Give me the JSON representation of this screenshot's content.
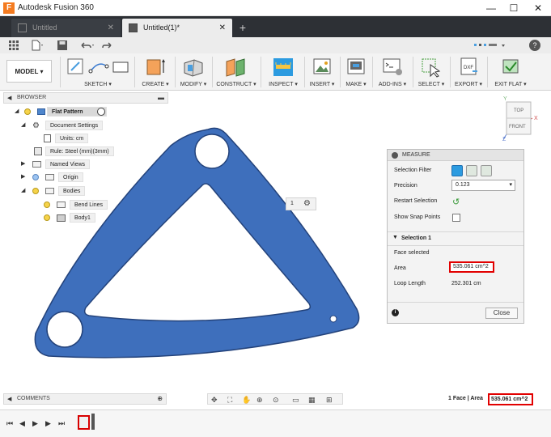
{
  "titlebar": {
    "app_icon_letter": "F",
    "title": "Autodesk Fusion 360",
    "minimize": "—",
    "maximize": "☐",
    "close": "✕"
  },
  "tabs": [
    {
      "label": "Untitled",
      "active": false,
      "close": "✕"
    },
    {
      "label": "Untitled(1)*",
      "active": true,
      "close": "✕"
    }
  ],
  "tab_add": "+",
  "quick_toolbar": {
    "help": "?"
  },
  "ribbon": {
    "workspace": "MODEL ▾",
    "groups": [
      "SKETCH ▾",
      "CREATE ▾",
      "MODIFY ▾",
      "CONSTRUCT ▾",
      "INSPECT ▾",
      "INSERT ▾",
      "MAKE ▾",
      "ADD-INS ▾",
      "SELECT ▾",
      "EXPORT ▾",
      "EXIT FLAT ▾"
    ],
    "accent": "#4a9fe0"
  },
  "browser": {
    "title": "BROWSER",
    "items": [
      {
        "label": "Flat Pattern"
      },
      {
        "label": "Document Settings"
      },
      {
        "label": "Units: cm"
      },
      {
        "label": "Rule: Steel (mm)(3mm)"
      },
      {
        "label": "Named Views"
      },
      {
        "label": "Origin"
      },
      {
        "label": "Bodies"
      },
      {
        "label": "Bend Lines"
      },
      {
        "label": "Body1"
      }
    ]
  },
  "part_tag": "1",
  "measure": {
    "title": "MEASURE",
    "selection_filter_label": "Selection Filter",
    "precision_label": "Precision",
    "precision_value": "0.123",
    "restart_label": "Restart Selection",
    "snap_label": "Show Snap Points",
    "section_title": "Selection 1",
    "face_selected": "Face selected",
    "area_label": "Area",
    "area_value": "535.061 cm^2",
    "loop_label": "Loop Length",
    "loop_value": "252.301 cm",
    "close_label": "Close"
  },
  "viewcube": {
    "top": "TOP",
    "front": "FRONT",
    "y_axis": "Y",
    "x_axis": "X",
    "z_axis": "Z"
  },
  "comments": {
    "title": "COMMENTS"
  },
  "status": {
    "selection": "1 Face | Area",
    "value": "535.061 cm^2"
  },
  "colors": {
    "part_fill": "#3e6fbc",
    "highlight": "#e20000"
  }
}
